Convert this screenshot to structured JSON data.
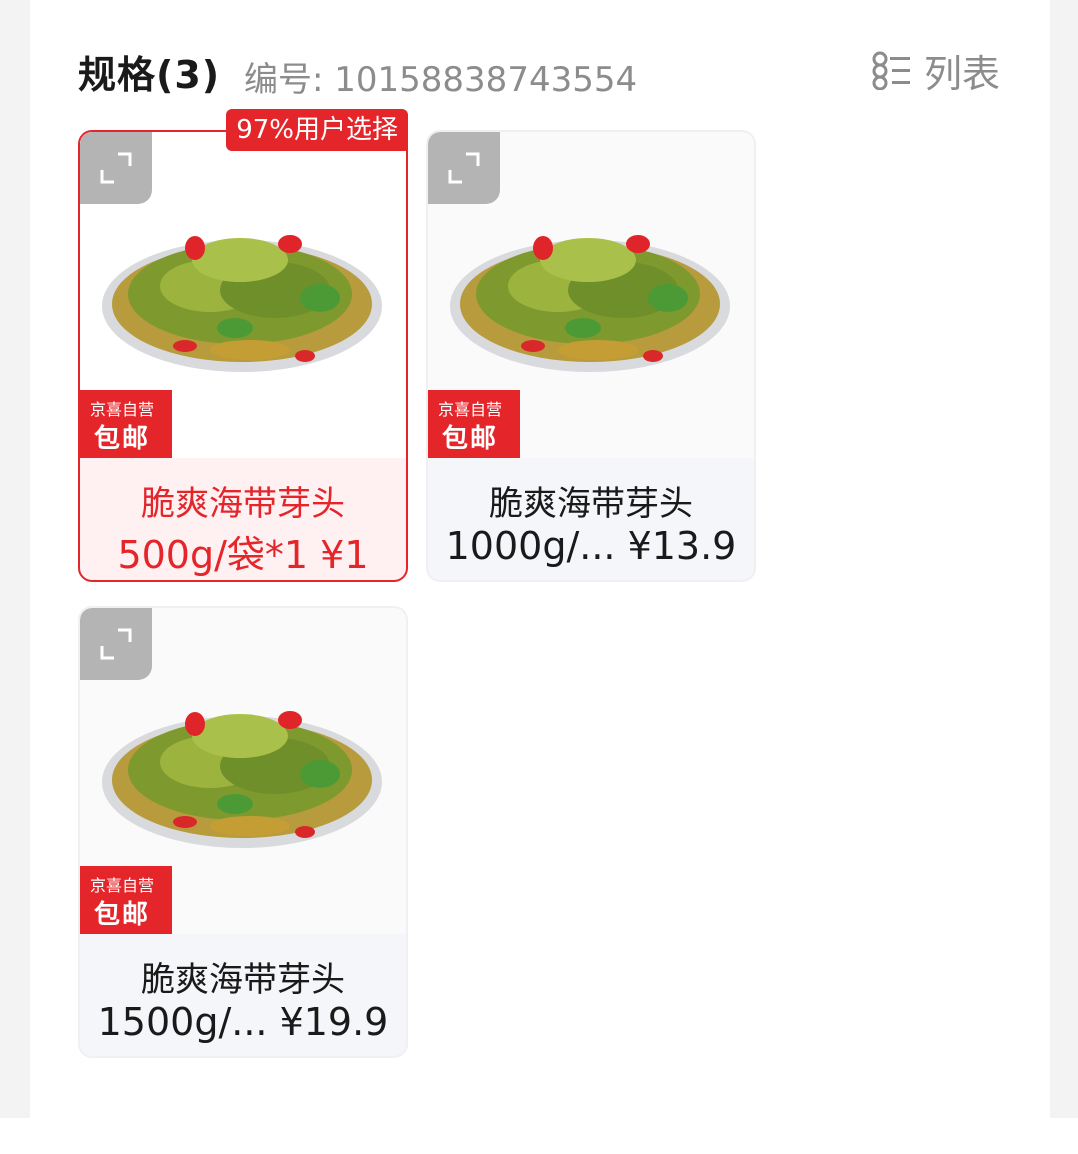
{
  "header": {
    "title": "规格(3)",
    "code_label": "编号: 10158838743554",
    "list_label": "列表"
  },
  "colors": {
    "accent": "#e4262b",
    "muted": "#8c8c8c",
    "text": "#1a1a1a"
  },
  "specs": [
    {
      "name": "脆爽海带芽头",
      "spec": "500g/袋*1 ¥1",
      "badge_top": "京喜自营",
      "badge_bottom": "包邮",
      "tag": "97%用户选择",
      "selected": true
    },
    {
      "name": "脆爽海带芽头",
      "spec": "1000g/... ¥13.9",
      "badge_top": "京喜自营",
      "badge_bottom": "包邮",
      "selected": false
    },
    {
      "name": "脆爽海带芽头",
      "spec": "1500g/... ¥19.9",
      "badge_top": "京喜自营",
      "badge_bottom": "包邮",
      "selected": false
    }
  ],
  "icons": {
    "expand": "expand-icon",
    "list": "list-view-icon"
  }
}
